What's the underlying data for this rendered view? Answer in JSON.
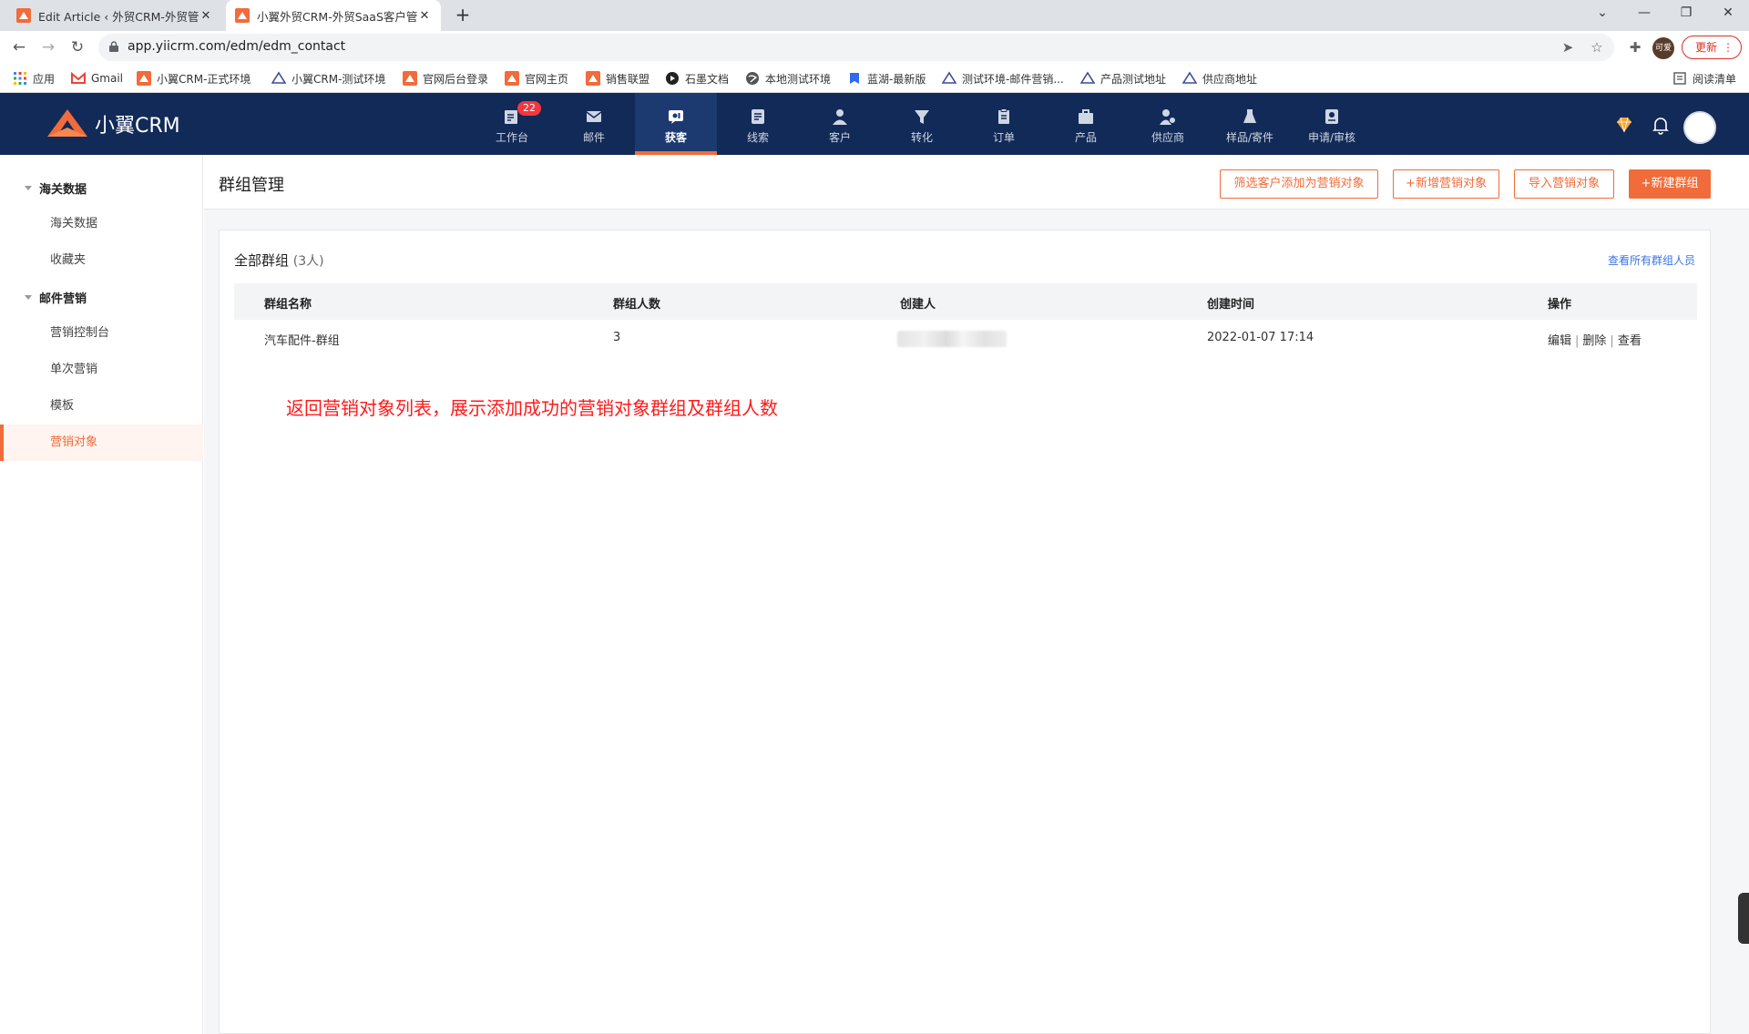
{
  "browser": {
    "tabs": [
      {
        "title": "Edit Article ‹ 外贸CRM-外贸管理",
        "close": "✕"
      },
      {
        "title": "小翼外贸CRM-外贸SaaS客户管理",
        "close": "✕"
      }
    ],
    "url": "app.yiicrm.com/edm/edm_contact",
    "profile_label": "可爱",
    "update_label": "更新",
    "bookmarks": [
      "应用",
      "Gmail",
      "小翼CRM-正式环境",
      "小翼CRM-测试环境",
      "官网后台登录",
      "官网主页",
      "销售联盟",
      "石墨文档",
      "本地测试环境",
      "蓝湖-最新版",
      "测试环境-邮件营销...",
      "产品测试地址",
      "供应商地址"
    ],
    "reading_list": "阅读清单"
  },
  "app": {
    "brand": "小翼CRM",
    "nav": [
      {
        "label": "工作台",
        "icon": "workbench-icon",
        "badge": "22"
      },
      {
        "label": "邮件",
        "icon": "mail-icon"
      },
      {
        "label": "获客",
        "icon": "acquire-icon",
        "active": true
      },
      {
        "label": "线索",
        "icon": "lead-icon"
      },
      {
        "label": "客户",
        "icon": "customer-icon"
      },
      {
        "label": "转化",
        "icon": "funnel-icon"
      },
      {
        "label": "订单",
        "icon": "order-icon"
      },
      {
        "label": "产品",
        "icon": "product-icon"
      },
      {
        "label": "供应商",
        "icon": "supplier-icon"
      },
      {
        "label": "样品/寄件",
        "icon": "sample-icon"
      },
      {
        "label": "申请/审核",
        "icon": "approval-icon"
      }
    ],
    "accent": "#f26b3a",
    "nav_bg": "#122a57"
  },
  "sidebar": {
    "groups": [
      {
        "label": "海关数据",
        "items": [
          "海关数据",
          "收藏夹"
        ]
      },
      {
        "label": "邮件营销",
        "items": [
          "营销控制台",
          "单次营销",
          "模板",
          "营销对象"
        ]
      }
    ],
    "active_item": "营销对象"
  },
  "page": {
    "title": "群组管理",
    "buttons": {
      "filter_add": "筛选客户添加为营销对象",
      "add_target": "+新增营销对象",
      "import_target": "导入营销对象",
      "new_group": "+新建群组"
    },
    "card": {
      "heading": "全部群组",
      "count": "(3人)",
      "view_all": "查看所有群组人员"
    },
    "table": {
      "columns": [
        "群组名称",
        "群组人数",
        "创建人",
        "创建时间",
        "操作"
      ],
      "rows": [
        {
          "name": "汽车配件-群组",
          "count": "3",
          "creator": "",
          "created_at": "2022-01-07 17:14",
          "actions": [
            "编辑",
            "删除",
            "查看"
          ]
        }
      ],
      "separator": "|"
    },
    "annotation": "返回营销对象列表，展示添加成功的营销对象群组及群组人数"
  }
}
